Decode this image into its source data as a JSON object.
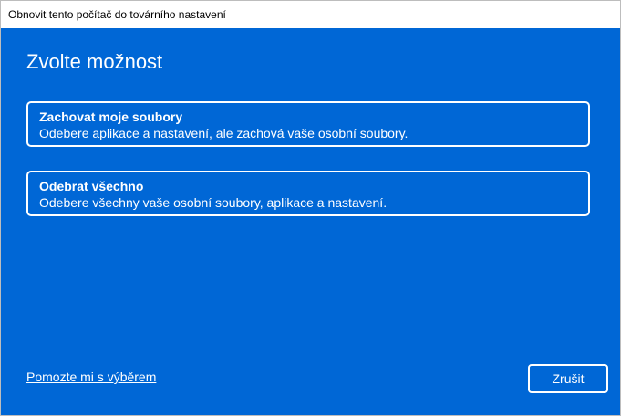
{
  "window": {
    "title": "Obnovit tento počítač do továrního nastavení"
  },
  "main": {
    "heading": "Zvolte možnost",
    "options": [
      {
        "title": "Zachovat moje soubory",
        "description": "Odebere aplikace a nastavení, ale zachová vaše osobní soubory."
      },
      {
        "title": "Odebrat všechno",
        "description": "Odebere všechny vaše osobní soubory, aplikace a nastavení."
      }
    ]
  },
  "footer": {
    "help_link": "Pomozte mi s výběrem",
    "cancel_label": "Zrušit"
  },
  "colors": {
    "background": "#0067d6",
    "titlebar": "#ffffff",
    "text": "#ffffff"
  }
}
